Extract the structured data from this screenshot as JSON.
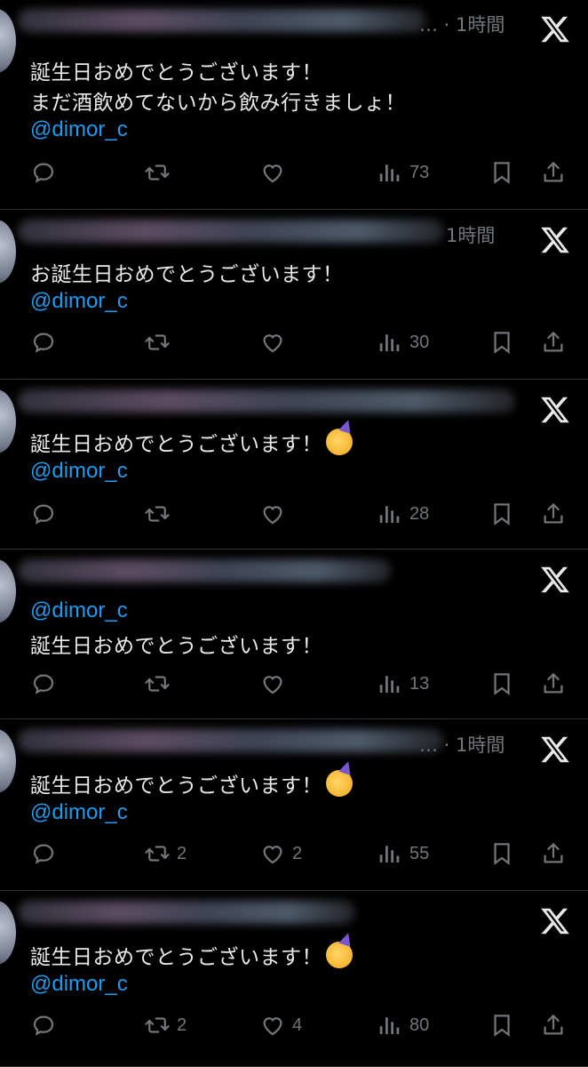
{
  "tweets": [
    {
      "time": "… · 1時間",
      "lines": [
        "誕生日おめでとうございます！",
        "まだ酒飲めてないから飲み行きましょ！"
      ],
      "mention": "@dimor_c",
      "mention_first": false,
      "emoji": false,
      "retweets": "",
      "likes": "",
      "views": "73"
    },
    {
      "time": "1時間",
      "lines": [
        "お誕生日おめでとうございます！"
      ],
      "mention": "@dimor_c",
      "mention_first": false,
      "emoji": false,
      "retweets": "",
      "likes": "",
      "views": "30"
    },
    {
      "time": "",
      "lines": [
        "誕生日おめでとうございます！"
      ],
      "mention": "@dimor_c",
      "mention_first": false,
      "emoji": true,
      "emoji_name": "partying-face",
      "retweets": "",
      "likes": "",
      "views": "28"
    },
    {
      "time": "",
      "lines": [
        "誕生日おめでとうございます！"
      ],
      "mention": "@dimor_c",
      "mention_first": true,
      "emoji": false,
      "retweets": "",
      "likes": "",
      "views": "13"
    },
    {
      "time": "… · 1時間",
      "lines": [
        "誕生日おめでとうございます！"
      ],
      "mention": "@dimor_c",
      "mention_first": false,
      "emoji": true,
      "emoji_name": "partying-face",
      "retweets": "2",
      "likes": "2",
      "views": "55"
    },
    {
      "time": "",
      "lines": [
        "誕生日おめでとうございます！"
      ],
      "mention": "@dimor_c",
      "mention_first": false,
      "emoji": true,
      "emoji_name": "partying-face",
      "retweets": "2",
      "likes": "4",
      "views": "80"
    }
  ],
  "colors": {
    "background": "#000000",
    "text": "#e7e9ea",
    "secondary": "#71767b",
    "mention": "#1d9bf0",
    "divider": "#2f3336"
  },
  "icons": [
    "reply-icon",
    "retweet-icon",
    "like-icon",
    "views-icon",
    "bookmark-icon",
    "share-icon",
    "x-logo-icon"
  ]
}
